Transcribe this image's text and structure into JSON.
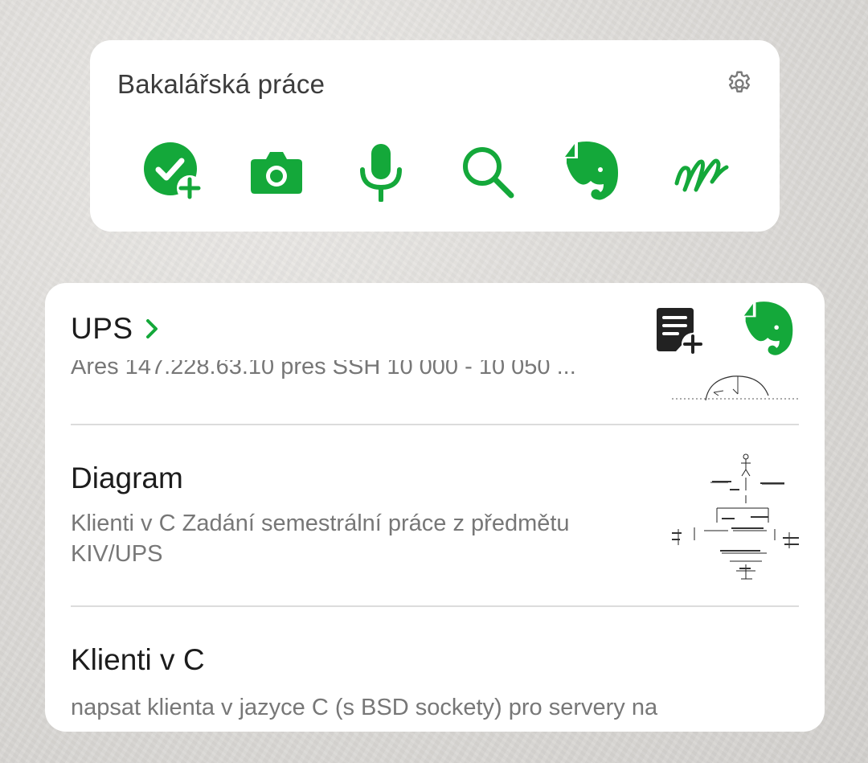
{
  "widget": {
    "notebook_title": "Bakalářská práce",
    "accent_color": "#14a83a",
    "actions": [
      {
        "name": "new-task",
        "icon": "check-plus-icon"
      },
      {
        "name": "camera",
        "icon": "camera-icon"
      },
      {
        "name": "audio",
        "icon": "microphone-icon"
      },
      {
        "name": "search",
        "icon": "search-icon"
      },
      {
        "name": "evernote",
        "icon": "elephant-icon"
      },
      {
        "name": "handwriting",
        "icon": "squiggle-icon"
      }
    ]
  },
  "list": {
    "title": "UPS",
    "notes": [
      {
        "title": "",
        "snippet": "Ares 147.228.63.10 pres SSH 10 000 - 10 050 ..."
      },
      {
        "title": "Diagram",
        "snippet": "Klienti v C Zadání semestrální práce z předmětu KIV/UPS"
      },
      {
        "title": "Klienti v C",
        "snippet": "napsat klienta v jazyce C (s BSD sockety) pro servery na"
      }
    ]
  }
}
